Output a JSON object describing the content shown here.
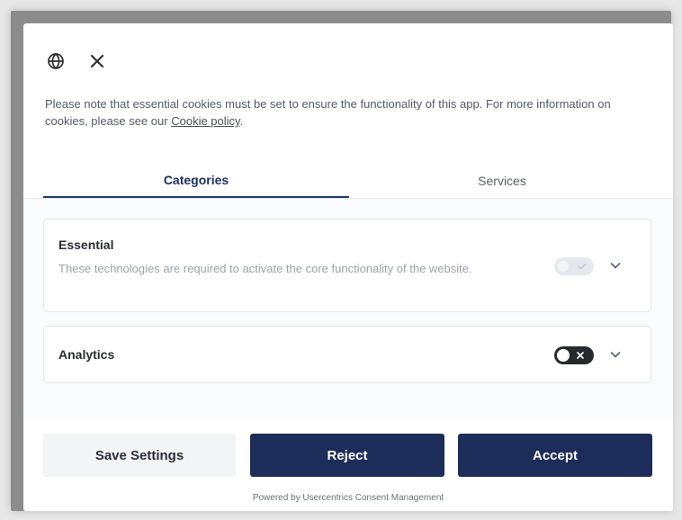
{
  "dialog": {
    "notice_text": "Please note that essential cookies must be set to ensure the functionality of this app. For more information on cookies, please see our",
    "cookie_policy_link": "Cookie policy",
    "notice_suffix": "."
  },
  "icons": {
    "language": "globe-icon",
    "close": "close-icon"
  },
  "tabs": [
    {
      "label": "Categories",
      "active": true
    },
    {
      "label": "Services",
      "active": false
    }
  ],
  "categories": [
    {
      "title": "Essential",
      "description": "These technologies are required to activate the core functionality of the website.",
      "enabled": true,
      "toggle_disabled": true
    },
    {
      "title": "Analytics",
      "enabled": false,
      "toggle_disabled": false
    }
  ],
  "footer": {
    "save_label": "Save Settings",
    "reject_label": "Reject",
    "accept_label": "Accept",
    "powered_by": "Powered by Usercentrics Consent Management"
  },
  "colors": {
    "brand": "#1d2d59",
    "active_tab": "#223c6d",
    "text_muted": "#9ca2ac"
  }
}
